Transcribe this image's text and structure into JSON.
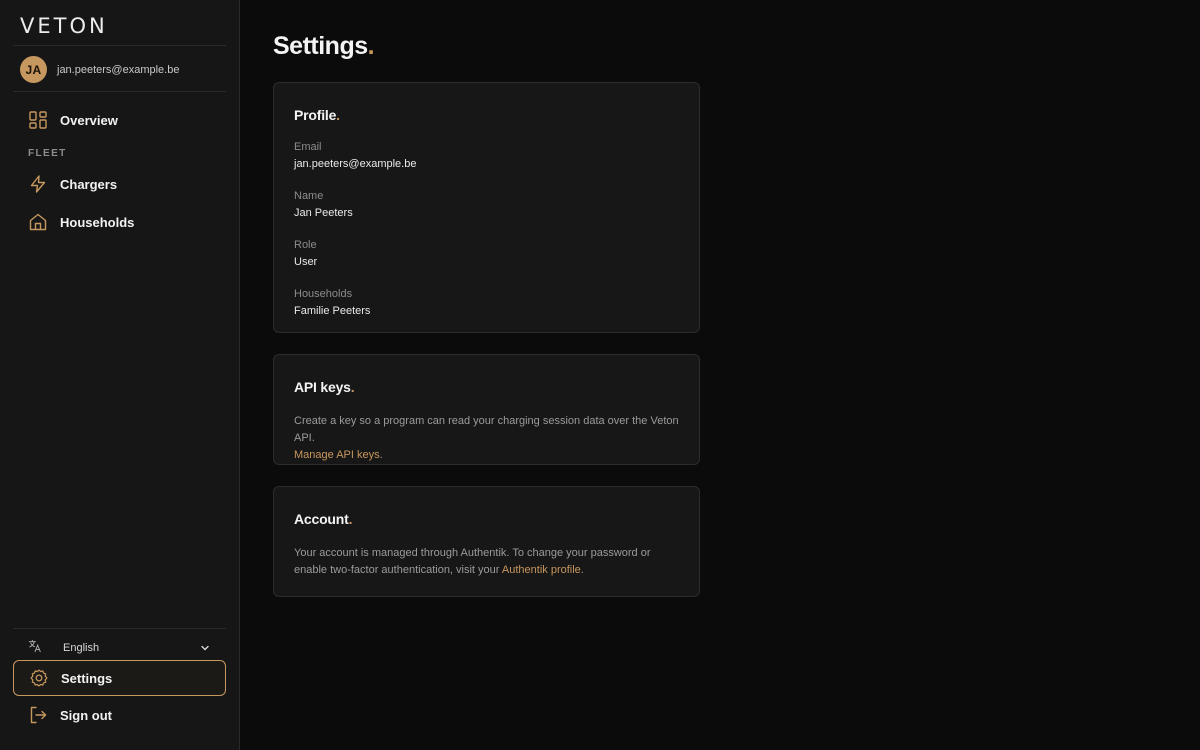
{
  "brand": {
    "logo": "VETON"
  },
  "user": {
    "initials": "JA",
    "email": "jan.peeters@example.be"
  },
  "nav": {
    "overview": "Overview",
    "section_fleet": "FLEET",
    "chargers": "Chargers",
    "households": "Households",
    "settings": "Settings",
    "sign_out": "Sign out"
  },
  "language": {
    "selected": "English"
  },
  "page": {
    "title": "Settings",
    "title_dot": "."
  },
  "profile": {
    "title": "Profile",
    "fields": [
      {
        "label": "Email",
        "value": "jan.peeters@example.be"
      },
      {
        "label": "Name",
        "value": "Jan Peeters"
      },
      {
        "label": "Role",
        "value": "User"
      },
      {
        "label": "Households",
        "value": "Familie Peeters"
      }
    ]
  },
  "api_keys": {
    "title": "API keys",
    "description": "Create a key so a program can read your charging session data over the Veton API.",
    "link": "Manage API keys",
    "link_suffix": "."
  },
  "account": {
    "title": "Account",
    "description": "Your account is managed through Authentik. To change your password or enable two-factor authentication, visit your ",
    "link": "Authentik profile",
    "link_suffix": "."
  },
  "colors": {
    "accent": "#c6975e",
    "background": "#0b0b0b",
    "sidebar": "#161616",
    "card": "#171717"
  },
  "icons": {
    "overview": "grid-icon",
    "chargers": "lightning-icon",
    "households": "home-icon",
    "language": "translate-icon",
    "settings": "gear-icon",
    "sign_out": "logout-icon"
  }
}
